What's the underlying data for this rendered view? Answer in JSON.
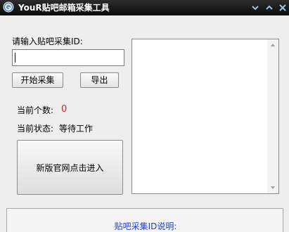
{
  "window": {
    "title": "YouR贴吧邮箱采集工具",
    "icon": "app-logo-icon",
    "controls": [
      {
        "name": "minimize-button",
        "icon": "chevron-down-icon"
      },
      {
        "name": "maximize-button",
        "icon": "chevron-up-icon"
      },
      {
        "name": "close-button",
        "icon": "close-icon"
      }
    ],
    "title_bar_color": "#111111"
  },
  "form": {
    "id_label": "请输入贴吧采集ID:",
    "id_value": "",
    "start_button": "开始采集",
    "export_button": "导出"
  },
  "status": {
    "count_label": "当前个数:",
    "count_value": "0",
    "state_label": "当前状态:",
    "state_value": "等待工作",
    "count_color": "#e02020"
  },
  "site_button": "新版官网点击进入",
  "result_list": {
    "items": []
  },
  "description": {
    "title": "贴吧采集ID说明:",
    "text_color": "#1d3fd0"
  }
}
